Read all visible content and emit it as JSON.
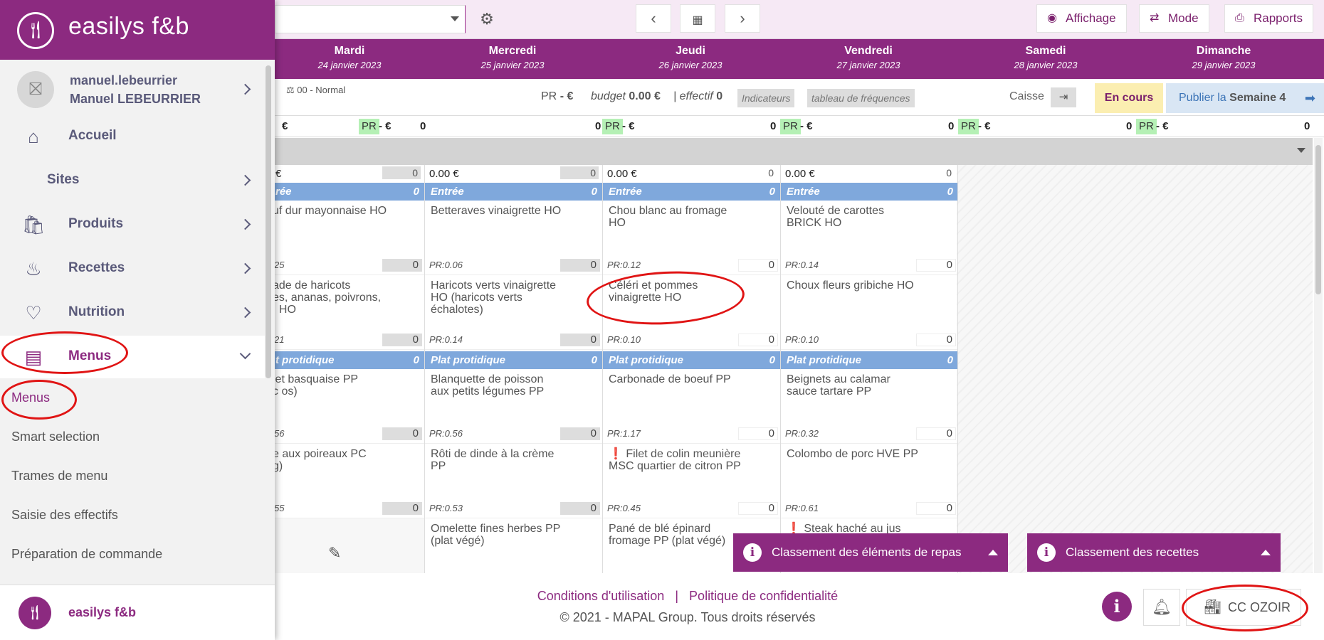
{
  "topbar": {
    "site_select_value": "",
    "prev_icon": "chevron-left",
    "calendar_icon": "calendar",
    "next_icon": "chevron-right",
    "affichage_label": "Affichage",
    "mode_label": "Mode",
    "rapports_label": "Rapports"
  },
  "days": [
    {
      "name": "Mardi",
      "date": "24 janvier 2023"
    },
    {
      "name": "Mercredi",
      "date": "25 janvier 2023"
    },
    {
      "name": "Jeudi",
      "date": "26 janvier 2023"
    },
    {
      "name": "Vendredi",
      "date": "27 janvier 2023"
    },
    {
      "name": "Samedi",
      "date": "28 janvier 2023"
    },
    {
      "name": "Dimanche",
      "date": "29 janvier 2023"
    }
  ],
  "info": {
    "normal_label": "00 - Normal",
    "pr_label": "PR",
    "pr_value": "- €",
    "budget_label": "budget",
    "budget_value": "0.00 €",
    "effectif_label": "| effectif",
    "effectif_value": "0",
    "indicateurs_label": "Indicateurs",
    "frequences_label": "tableau de fréquences",
    "caisse_label": "Caisse",
    "encours_label": "En cours",
    "publier_label": "Publier la",
    "semaine_label": "Semaine 4"
  },
  "pr_row": [
    {
      "left": "€",
      "val": "0"
    },
    {
      "tag": "PR",
      "left": "- €",
      "val": "0"
    },
    {
      "tag": "PR",
      "left": "- €",
      "val": "0"
    },
    {
      "tag": "PR",
      "left": "- €",
      "val": "0"
    },
    {
      "tag": "PR",
      "left": "- €",
      "val": "0"
    },
    {
      "tag": "PR",
      "left": "- €",
      "val": "0"
    }
  ],
  "columns": [
    {
      "top_amount": "€",
      "top_val": "0",
      "sec1": "rée",
      "sec1_n": "0",
      "items1": [
        {
          "title": "uf dur mayonnaise HO",
          "pr": "25",
          "qty": "0"
        },
        {
          "title": "ade de haricots\nes, ananas, poivrons,\n; HO",
          "pr": "21",
          "qty": "0"
        }
      ],
      "sec2": "t protidique",
      "sec2_n": "0",
      "items2": [
        {
          "title": "let basquaise PP\nc os)",
          "pr": "56",
          "qty": "0"
        },
        {
          "title": "e aux poireaux PC\ng)",
          "pr": "55",
          "qty": "0"
        }
      ],
      "edit_icon": "pencil"
    },
    {
      "top_amount": "0.00 €",
      "top_val": "0",
      "sec1": "Entrée",
      "sec1_n": "0",
      "items1": [
        {
          "title": "Betteraves vinaigrette HO",
          "pr": "PR:0.06",
          "qty": "0"
        },
        {
          "title": "Haricots verts vinaigrette\nHO (haricots verts\néchalotes)",
          "pr": "PR:0.14",
          "qty": "0"
        }
      ],
      "sec2": "Plat protidique",
      "sec2_n": "0",
      "items2": [
        {
          "title": "Blanquette de poisson\naux petits légumes PP",
          "pr": "PR:0.56",
          "qty": "0"
        },
        {
          "title": "Rôti de dinde à la crème\nPP",
          "pr": "PR:0.53",
          "qty": "0"
        }
      ],
      "item_extra": {
        "title": "Omelette fines herbes PP\n(plat végé)"
      }
    },
    {
      "top_amount": "0.00 €",
      "top_val": "0",
      "sec1": "Entrée",
      "sec1_n": "0",
      "items1": [
        {
          "title": "Chou blanc au fromage\nHO",
          "pr": "PR:0.12",
          "qty": "0"
        },
        {
          "title": "Céléri et pommes\nvinaigrette HO",
          "pr": "PR:0.10",
          "qty": "0"
        }
      ],
      "sec2": "Plat protidique",
      "sec2_n": "0",
      "items2": [
        {
          "title": "Carbonade de boeuf PP",
          "pr": "PR:1.17",
          "qty": "0"
        },
        {
          "title": "❗ Filet de colin meunière\nMSC quartier de citron PP",
          "pr": "PR:0.45",
          "qty": "0"
        }
      ],
      "item_extra": {
        "title": "Pané de blé épinard\nfromage PP (plat végé)"
      }
    },
    {
      "top_amount": "0.00 €",
      "top_val": "0",
      "sec1": "Entrée",
      "sec1_n": "0",
      "items1": [
        {
          "title": "Velouté de carottes\nBRICK HO",
          "pr": "PR:0.14",
          "qty": "0"
        },
        {
          "title": "Choux fleurs gribiche HO",
          "pr": "PR:0.10",
          "qty": "0"
        }
      ],
      "sec2": "Plat protidique",
      "sec2_n": "0",
      "items2": [
        {
          "title": "Beignets au calamar\nsauce tartare PP",
          "pr": "PR:0.32",
          "qty": "0"
        },
        {
          "title": "Colombo de porc HVE PP",
          "pr": "PR:0.61",
          "qty": "0"
        }
      ],
      "item_extra": {
        "title": "❗ Steak haché au jus"
      }
    }
  ],
  "panels": {
    "elements_label": "Classement des éléments de repas",
    "recettes_label": "Classement des recettes"
  },
  "footer": {
    "conditions_label": "Conditions d'utilisation",
    "separator": "|",
    "politique_label": "Politique de confidentialité",
    "copyright": "© 2021 - MAPAL Group. Tous droits réservés",
    "site_label": "CC OZOIR"
  },
  "sidebar": {
    "brand": "easilys f&b",
    "user_login": "manuel.lebeurrier",
    "user_name": "Manuel LEBEURRIER",
    "items": [
      {
        "label": "Accueil"
      },
      {
        "label": "Sites"
      },
      {
        "label": "Produits"
      },
      {
        "label": "Recettes"
      },
      {
        "label": "Nutrition"
      },
      {
        "label": "Menus"
      }
    ],
    "sub_items": [
      {
        "label": "Menus"
      },
      {
        "label": "Smart selection"
      },
      {
        "label": "Trames de menu"
      },
      {
        "label": "Saisie des effectifs"
      },
      {
        "label": "Préparation de commande"
      }
    ],
    "footer_brand": "easilys f&b"
  },
  "colors": {
    "brand": "#8c2a80",
    "section": "#7fa8dc",
    "annotation": "#e01414"
  }
}
